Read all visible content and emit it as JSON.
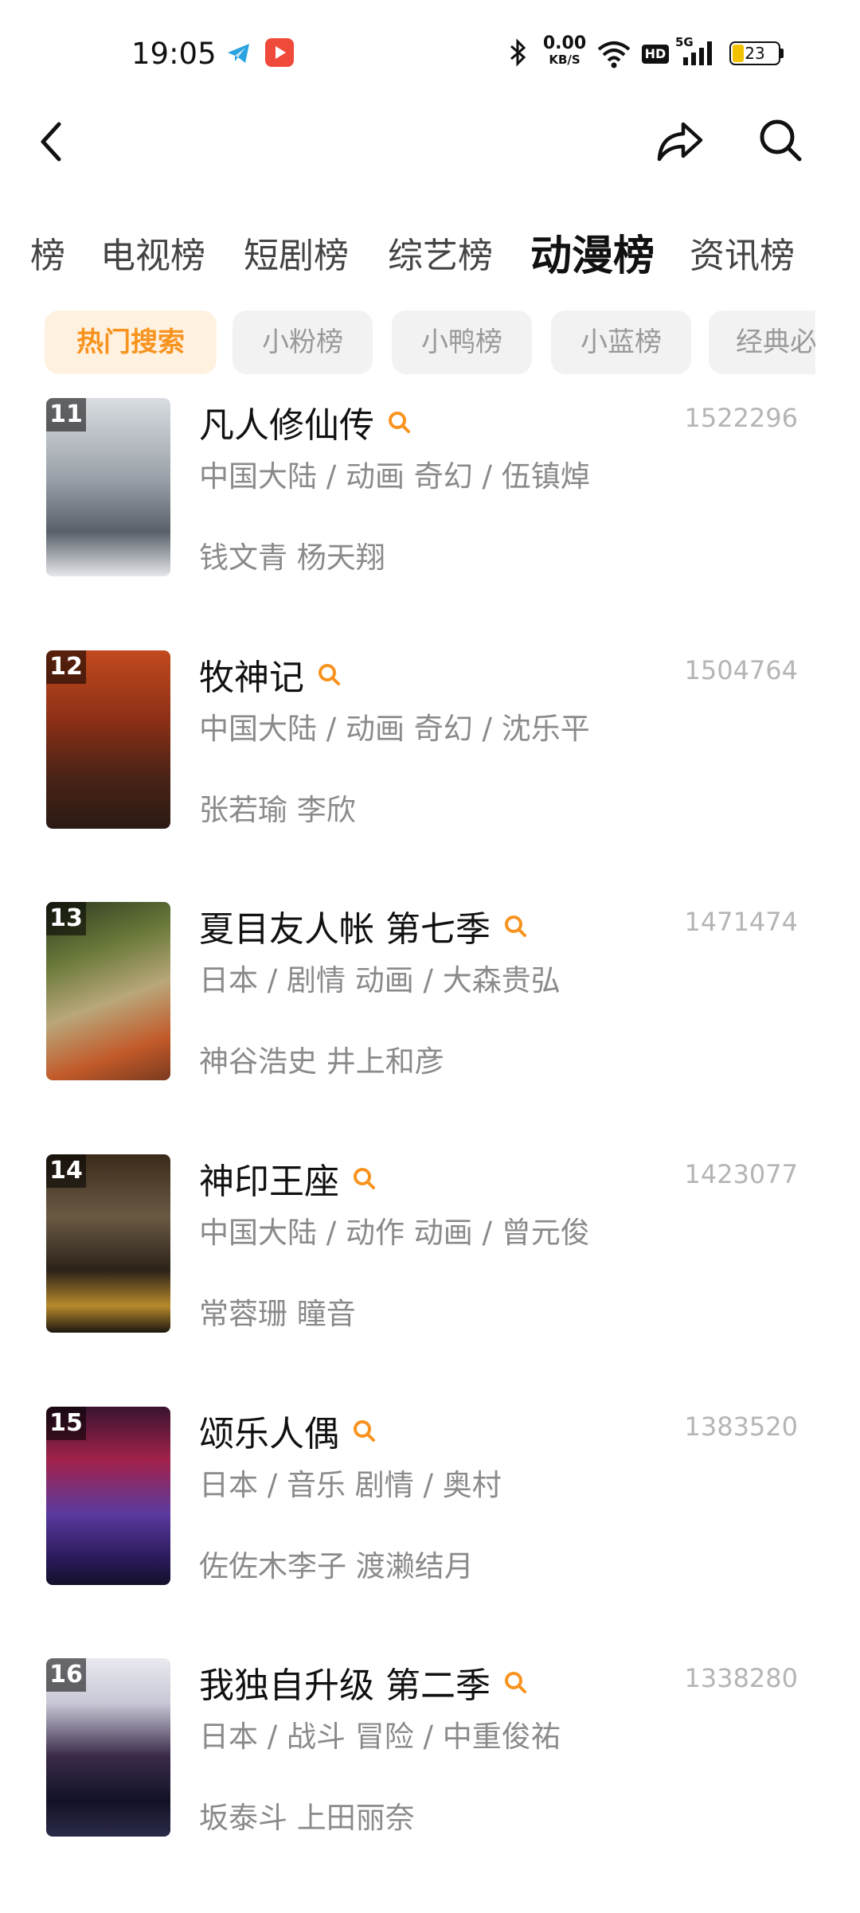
{
  "status_bar": {
    "time": "19:05",
    "net_speed_value": "0.00",
    "net_speed_unit": "KB/S",
    "hd": "HD",
    "signal_label": "5G",
    "battery": "23"
  },
  "nav": {
    "icons": [
      "back-icon",
      "share-icon",
      "search-icon"
    ]
  },
  "category_tabs": [
    "榜",
    "电视榜",
    "短剧榜",
    "综艺榜",
    "动漫榜",
    "资讯榜"
  ],
  "active_category": "动漫榜",
  "sub_filters": [
    "热门搜索",
    "小粉榜",
    "小鸭榜",
    "小蓝榜",
    "经典必"
  ],
  "active_sub_filter": "热门搜索",
  "accent_color": "#f7931e",
  "items": [
    {
      "rank": "11",
      "title": "凡人修仙传",
      "meta": "中国大陆 / 动画 奇幻 / 伍镇焯",
      "cast": "钱文青 杨天翔",
      "count": "1522296"
    },
    {
      "rank": "12",
      "title": "牧神记",
      "meta": "中国大陆 / 动画 奇幻 / 沈乐平",
      "cast": "张若瑜 李欣",
      "count": "1504764"
    },
    {
      "rank": "13",
      "title": "夏目友人帐 第七季",
      "meta": "日本 / 剧情 动画 / 大森贵弘",
      "cast": "神谷浩史 井上和彦",
      "count": "1471474"
    },
    {
      "rank": "14",
      "title": "神印王座",
      "meta": "中国大陆 / 动作 动画 / 曾元俊",
      "cast": "常蓉珊 瞳音",
      "count": "1423077"
    },
    {
      "rank": "15",
      "title": "颂乐人偶",
      "meta": "日本 / 音乐 剧情 / 奥村",
      "cast": "佐佐木李子 渡濑结月",
      "count": "1383520"
    },
    {
      "rank": "16",
      "title": "我独自升级 第二季",
      "meta": "日本 / 战斗 冒险 / 中重俊祐",
      "cast": "坂泰斗 上田丽奈",
      "count": "1338280"
    }
  ]
}
